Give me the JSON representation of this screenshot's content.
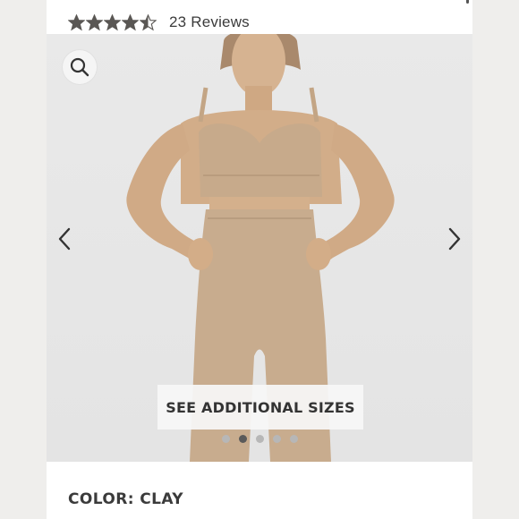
{
  "rating": {
    "value": 4.5,
    "max": 5,
    "reviews_label": "23 Reviews",
    "star_color": "#5a5754"
  },
  "gallery": {
    "zoom_icon": "magnifier-icon",
    "prev_icon": "chevron-left-icon",
    "next_icon": "chevron-right-icon",
    "cta_label": "SEE ADDITIONAL SIZES",
    "total_slides": 5,
    "active_slide": 2,
    "garment_color": "#c9ad8e"
  },
  "product": {
    "color_label": "COLOR: CLAY"
  }
}
